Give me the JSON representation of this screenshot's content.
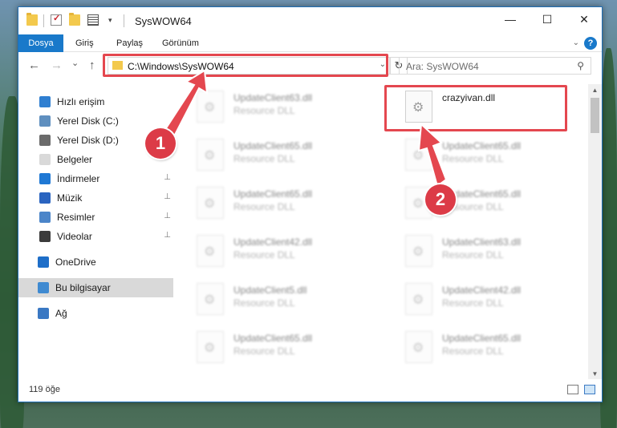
{
  "window": {
    "title": "SysWOW64"
  },
  "titlebar": {
    "minimize_glyph": "—",
    "maximize_glyph": "☐",
    "close_glyph": "✕"
  },
  "ribbon": {
    "tabs": [
      "Dosya",
      "Giriş",
      "Paylaş",
      "Görünüm"
    ],
    "help_glyph": "?"
  },
  "navigation": {
    "back_glyph": "←",
    "forward_glyph": "→",
    "recent_glyph": "⌄",
    "up_glyph": "↑",
    "address": "C:\\Windows\\SysWOW64",
    "refresh_glyph": "↻",
    "search_placeholder": "Ara: SysWOW64",
    "search_glyph": "⚲"
  },
  "sidebar": {
    "items": [
      {
        "label": "Hızlı erişim",
        "icon": "star-icon",
        "color": "#2f7fd1",
        "pinned": false
      },
      {
        "label": "Yerel Disk (C:)",
        "icon": "drive-icon",
        "color": "#5f8fbf",
        "pinned": false
      },
      {
        "label": "Yerel Disk (D:)",
        "icon": "drive-icon",
        "color": "#6b6b6b",
        "pinned": false
      },
      {
        "label": "Belgeler",
        "icon": "documents-icon",
        "color": "#d9d9d9",
        "pinned": false
      },
      {
        "label": "İndirmeler",
        "icon": "download-icon",
        "color": "#1f78d4",
        "pinned": true
      },
      {
        "label": "Müzik",
        "icon": "music-icon",
        "color": "#2a64c0",
        "pinned": true
      },
      {
        "label": "Resimler",
        "icon": "pictures-icon",
        "color": "#4b85c9",
        "pinned": true
      },
      {
        "label": "Videolar",
        "icon": "videos-icon",
        "color": "#3b3b3b",
        "pinned": true
      },
      {
        "label": "OneDrive",
        "icon": "cloud-icon",
        "color": "#1e6ec8",
        "pinned": false
      },
      {
        "label": "Bu bilgisayar",
        "icon": "computer-icon",
        "color": "#3f8ad1",
        "pinned": false,
        "selected": true
      },
      {
        "label": "Ağ",
        "icon": "network-icon",
        "color": "#3a78c3",
        "pinned": false
      }
    ],
    "pin_glyph": "📌"
  },
  "files": [
    {
      "name": "UpdateClient63.dll",
      "type": "Resource DLL"
    },
    {
      "name": "crazyivan.dll",
      "type": "",
      "highlighted": true
    },
    {
      "name": "UpdateClient65.dll",
      "type": "Resource DLL"
    },
    {
      "name": "UpdateClient65.dll",
      "type": "Resource DLL"
    },
    {
      "name": "UpdateClient65.dll",
      "type": "Resource DLL"
    },
    {
      "name": "UpdateClient65.dll",
      "type": "Resource DLL"
    },
    {
      "name": "UpdateClient42.dll",
      "type": "Resource DLL"
    },
    {
      "name": "UpdateClient63.dll",
      "type": "Resource DLL"
    },
    {
      "name": "UpdateClient5.dll",
      "type": "Resource DLL"
    },
    {
      "name": "UpdateClient42.dll",
      "type": "Resource DLL"
    },
    {
      "name": "UpdateClient65.dll",
      "type": "Resource DLL"
    },
    {
      "name": "UpdateClient65.dll",
      "type": "Resource DLL"
    }
  ],
  "status": {
    "count": "119 öğe"
  },
  "scrollbar": {
    "up_glyph": "▲",
    "down_glyph": "▼"
  },
  "annotations": {
    "step1": "1",
    "step2": "2",
    "color": "#e4474f"
  }
}
